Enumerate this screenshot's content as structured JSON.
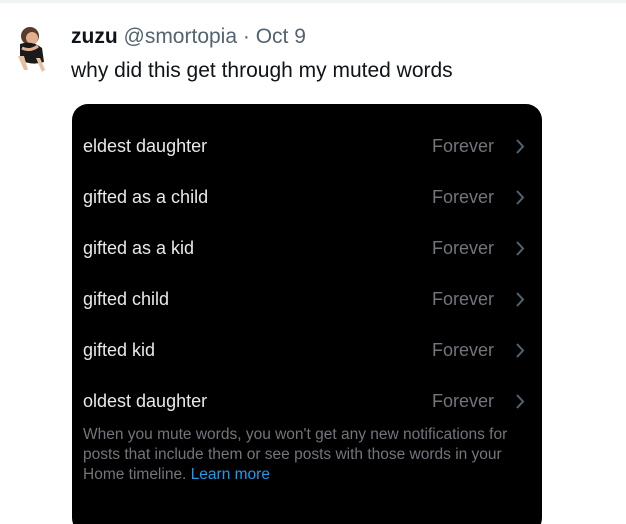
{
  "tweet": {
    "author_name": "zuzu",
    "handle": "@smortopia",
    "separator": "·",
    "date": "Oct 9",
    "text": "why did this get through my muted words"
  },
  "muted_words": {
    "rows": [
      {
        "word": "eldest daughter",
        "duration": "Forever"
      },
      {
        "word": "gifted as a child",
        "duration": "Forever"
      },
      {
        "word": "gifted as a kid",
        "duration": "Forever"
      },
      {
        "word": "gifted child",
        "duration": "Forever"
      },
      {
        "word": "gifted kid",
        "duration": "Forever"
      },
      {
        "word": "oldest daughter",
        "duration": "Forever"
      }
    ],
    "footnote": "When you mute words, you won't get any new notifications for posts that include them or see posts with those words in your Home timeline.",
    "learn_more": "Learn more"
  },
  "colors": {
    "accent": "#1d9bf0",
    "text_primary": "#0f1419",
    "text_secondary": "#536471",
    "media_background": "#000000"
  },
  "icons": {
    "row_chevron": "chevron-right-icon"
  }
}
